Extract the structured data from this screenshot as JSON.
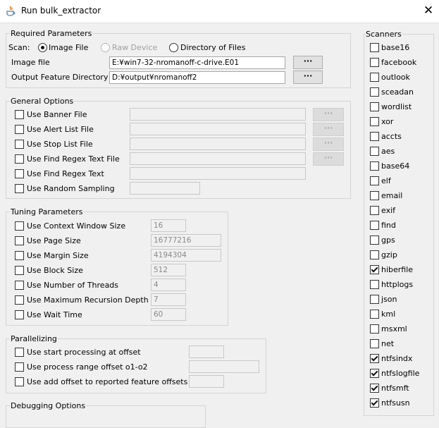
{
  "window": {
    "title": "Run bulk_extractor",
    "close_label": "✕"
  },
  "required": {
    "group_label": "Required Parameters",
    "scan_label": "Scan:",
    "options": [
      "Image File",
      "Raw Device",
      "Directory of Files"
    ],
    "selected_option": "Image File",
    "image_file_label": "Image file",
    "image_file_value": "E:¥win7-32-nromanoff-c-drive.E01",
    "output_label": "Output Feature Directory",
    "output_value": "D:¥output¥nromanoff2",
    "browse_label": "···"
  },
  "general": {
    "group_label": "General Options",
    "items": [
      {
        "label": "Use Banner File",
        "browse": true
      },
      {
        "label": "Use Alert List File",
        "browse": true
      },
      {
        "label": "Use Stop List File",
        "browse": true
      },
      {
        "label": "Use Find Regex Text File",
        "browse": true
      },
      {
        "label": "Use Find Regex Text",
        "browse": false
      },
      {
        "label": "Use Random Sampling",
        "browse": false
      }
    ]
  },
  "tuning": {
    "group_label": "Tuning Parameters",
    "items": [
      {
        "label": "Use Context Window Size",
        "value": "16"
      },
      {
        "label": "Use Page Size",
        "value": "16777216"
      },
      {
        "label": "Use Margin Size",
        "value": "4194304"
      },
      {
        "label": "Use Block Size",
        "value": "512"
      },
      {
        "label": "Use Number of Threads",
        "value": "4"
      },
      {
        "label": "Use Maximum Recursion Depth",
        "value": "7"
      },
      {
        "label": "Use Wait Time",
        "value": "60"
      }
    ]
  },
  "parallel": {
    "group_label": "Parallelizing",
    "items": [
      {
        "label": "Use start processing at offset"
      },
      {
        "label": "Use process range offset o1-o2"
      },
      {
        "label": "Use add offset to reported feature offsets"
      }
    ]
  },
  "debugging": {
    "group_label": "Debugging Options"
  },
  "scanners": {
    "group_label": "Scanners",
    "items": [
      {
        "name": "base16",
        "checked": false
      },
      {
        "name": "facebook",
        "checked": false
      },
      {
        "name": "outlook",
        "checked": false
      },
      {
        "name": "sceadan",
        "checked": false
      },
      {
        "name": "wordlist",
        "checked": false
      },
      {
        "name": "xor",
        "checked": false
      },
      {
        "name": "accts",
        "checked": false
      },
      {
        "name": "aes",
        "checked": false
      },
      {
        "name": "base64",
        "checked": false
      },
      {
        "name": "elf",
        "checked": false
      },
      {
        "name": "email",
        "checked": false
      },
      {
        "name": "exif",
        "checked": false
      },
      {
        "name": "find",
        "checked": false
      },
      {
        "name": "gps",
        "checked": false
      },
      {
        "name": "gzip",
        "checked": false
      },
      {
        "name": "hiberfile",
        "checked": true
      },
      {
        "name": "httplogs",
        "checked": false
      },
      {
        "name": "json",
        "checked": false
      },
      {
        "name": "kml",
        "checked": false
      },
      {
        "name": "msxml",
        "checked": false
      },
      {
        "name": "net",
        "checked": false
      },
      {
        "name": "ntfsindx",
        "checked": true
      },
      {
        "name": "ntfslogfile",
        "checked": true
      },
      {
        "name": "ntfsmft",
        "checked": true
      },
      {
        "name": "ntfsusn",
        "checked": true
      }
    ]
  }
}
